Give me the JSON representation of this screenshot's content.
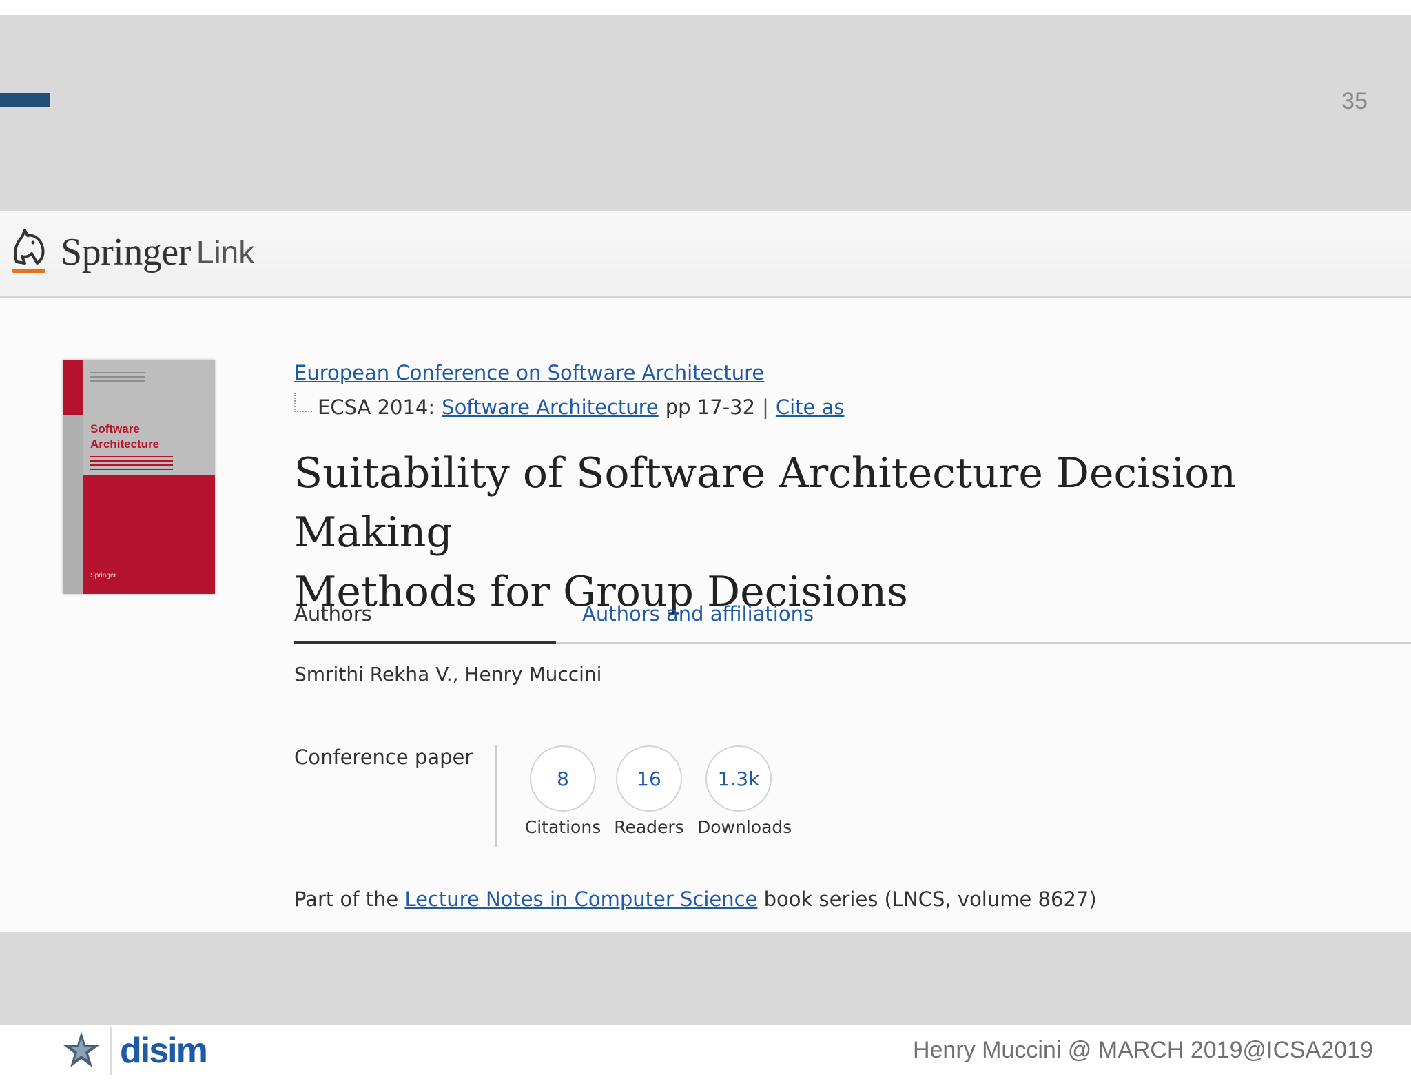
{
  "slide": {
    "number": "35",
    "footer_credit": "Henry Muccini @ MARCH 2019@ICSA2019",
    "org_logo_text": "disim"
  },
  "springer": {
    "brand": "Springer",
    "brand_suffix": "Link"
  },
  "book_cover": {
    "title_line1": "Software",
    "title_line2": "Architecture",
    "publisher": "Springer"
  },
  "breadcrumb": {
    "conference_link": "European Conference on Software Architecture",
    "event_prefix": "ECSA 2014:",
    "book_link": "Software Architecture",
    "pages": "pp 17-32",
    "separator": "|",
    "cite_link": "Cite as"
  },
  "paper": {
    "title_line1": "Suitability of Software Architecture Decision Making",
    "title_line2": "Methods for Group Decisions"
  },
  "tabs": {
    "authors": "Authors",
    "affiliations": "Authors and affiliations"
  },
  "authors": "Smrithi Rekha V., Henry Muccini",
  "metrics": {
    "content_type": "Conference paper",
    "items": [
      {
        "value": "8",
        "label": "Citations"
      },
      {
        "value": "16",
        "label": "Readers"
      },
      {
        "value": "1.3k",
        "label": "Downloads"
      }
    ]
  },
  "series": {
    "prefix": "Part of the",
    "link": "Lecture Notes in Computer Science",
    "suffix": "book series (LNCS, volume 8627)"
  },
  "colors": {
    "link": "#1f5aa8",
    "accent_bar": "#1f4e79",
    "cover_red": "#b5122e",
    "slide_gray": "#d9d9d9"
  }
}
